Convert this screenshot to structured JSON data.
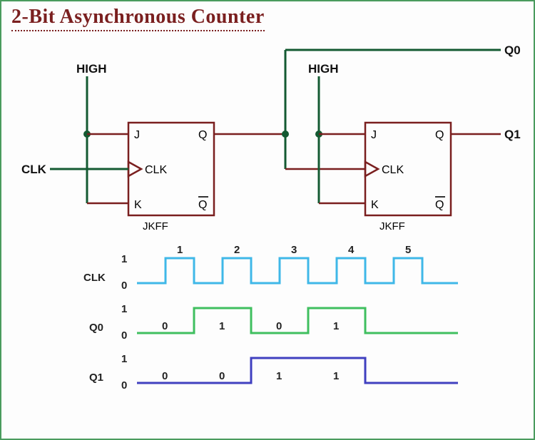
{
  "title": "2-Bit Asynchronous Counter",
  "inputs": {
    "high": "HIGH",
    "clk": "CLK"
  },
  "outputs": {
    "q0": "Q0",
    "q1": "Q1"
  },
  "ff": {
    "j": "J",
    "k": "K",
    "q": "Q",
    "qbar": "Q",
    "clk": "CLK",
    "caption": "JKFF"
  },
  "timing": {
    "levels": {
      "hi": "1",
      "lo": "0"
    },
    "clk_label": "CLK",
    "q0_label": "Q0",
    "q1_label": "Q1",
    "clk_ticks": [
      "1",
      "2",
      "3",
      "4",
      "5"
    ],
    "q0_vals": [
      "0",
      "1",
      "0",
      "1"
    ],
    "q1_vals": [
      "0",
      "0",
      "1",
      "1"
    ]
  },
  "chart_data": {
    "type": "timing",
    "title": "2-Bit Asynchronous Counter timing diagram",
    "signals": [
      {
        "name": "CLK",
        "color": "#3fb8e8",
        "type": "clock",
        "cycles": 5,
        "values": [
          0,
          1,
          0,
          1,
          0,
          1,
          0,
          1,
          0,
          1,
          0
        ]
      },
      {
        "name": "Q0",
        "color": "#3fbf5f",
        "values": [
          0,
          1,
          0,
          1,
          0
        ]
      },
      {
        "name": "Q1",
        "color": "#4040c0",
        "values": [
          0,
          0,
          1,
          1,
          0
        ]
      }
    ],
    "ylim": [
      0,
      1
    ]
  }
}
